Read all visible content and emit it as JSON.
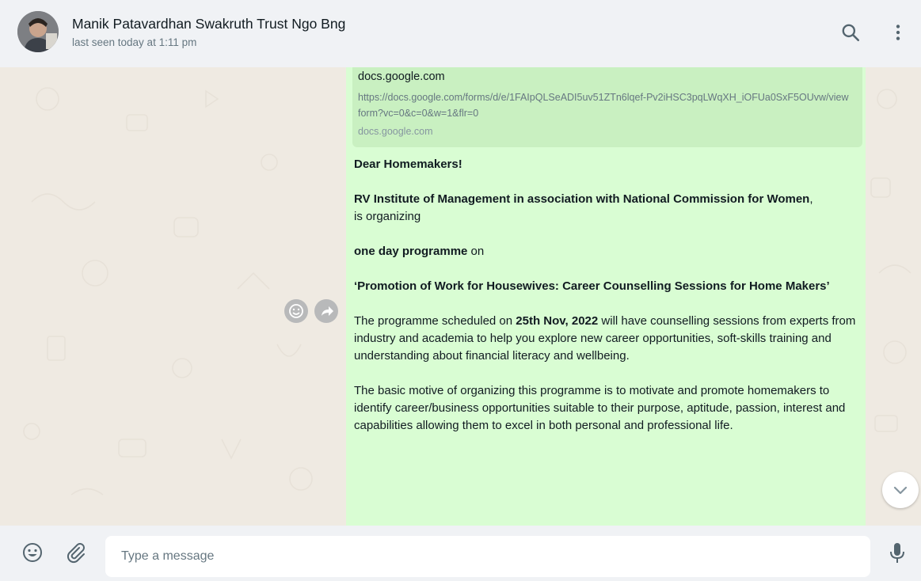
{
  "header": {
    "contact_name": "Manik Patavardhan Swakruth Trust Ngo Bng",
    "last_seen": "last seen today at 1:11 pm",
    "icons": [
      "avatar",
      "search-icon",
      "menu-icon"
    ]
  },
  "link_preview": {
    "title": "docs.google.com",
    "url": "https://docs.google.com/forms/d/e/1FAIpQLSeADI5uv51ZTn6lqef-Pv2iHSC3pqLWqXH_iOFUa0SxF5OUvw/viewform?vc=0&c=0&w=1&flr=0",
    "domain": "docs.google.com"
  },
  "message": {
    "greeting": "Dear Homemakers!",
    "org": "RV Institute of Management in association with National Commission for Women",
    "org_comma": ",",
    "organizing": "is organizing",
    "programme_bold": "one day programme",
    "programme_on": " on",
    "title": "‘Promotion of Work for Housewives: Career Counselling Sessions for Home Makers’",
    "p1_a": "The programme scheduled on ",
    "p1_date": "25th Nov, 2022",
    "p1_b": " will have counselling sessions from experts from industry and academia to help you explore new career opportunities, soft-skills training and understanding about financial literacy and wellbeing.",
    "p2": "The basic motive of organizing this programme is to motivate and promote homemakers to identify career/business opportunities suitable to their purpose, aptitude, passion, interest and capabilities allowing them to excel in both personal and professional life."
  },
  "footer": {
    "placeholder": "Type a message",
    "icons": [
      "emoji-icon",
      "attach-icon",
      "mic-icon"
    ]
  },
  "colors": {
    "bubble": "#d9fdd3",
    "preview": "#c9f0c1",
    "header": "#f0f2f5",
    "chat_bg": "#efeae2"
  }
}
